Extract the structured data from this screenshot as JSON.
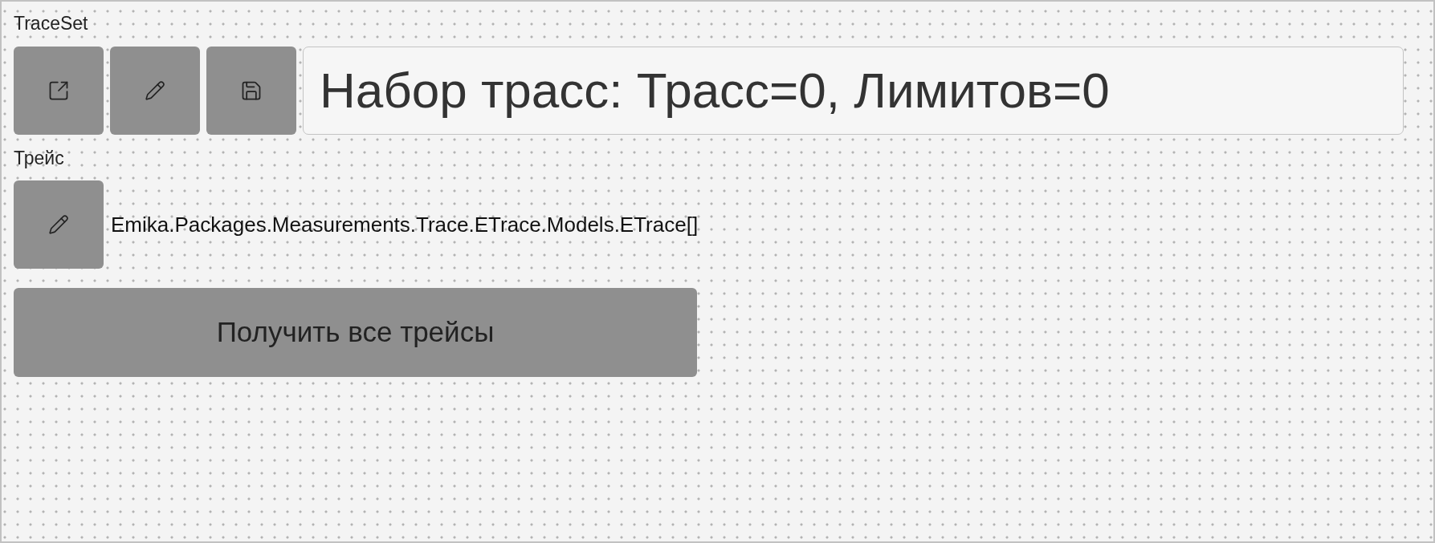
{
  "traceset": {
    "label": "TraceSet",
    "title_field": {
      "value": "Набор трасс: Трасс=0, Лимитов=0"
    }
  },
  "trace": {
    "label": "Трейс",
    "value": "Emika.Packages.Measurements.Trace.ETrace.Models.ETrace[]"
  },
  "action_button": {
    "label": "Получить все трейсы"
  }
}
